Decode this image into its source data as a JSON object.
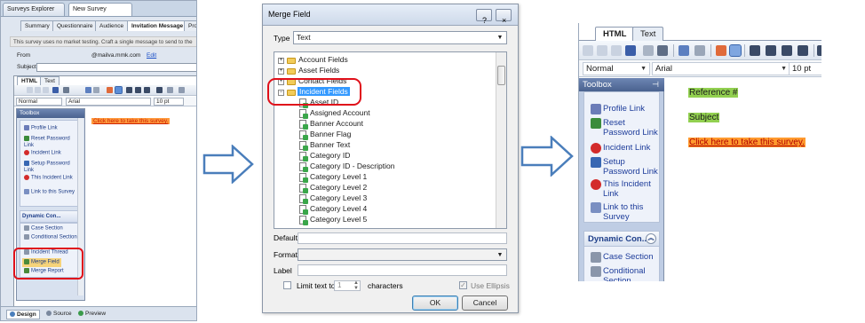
{
  "panel1": {
    "browser_tabs": [
      "Surveys Explorer",
      "New Survey"
    ],
    "sub_tabs": [
      "Summary",
      "Questionnaire",
      "Audience",
      "Invitation Message",
      "Pro"
    ],
    "banner": "This survey uses no market testing. Craft a single message to send to the",
    "from_label": "From",
    "from_value": "@mailva.mmk.com",
    "from_edit": "Edit",
    "subject_label": "Subject",
    "editor_tabs": [
      "HTML",
      "Text"
    ],
    "style_value": "Normal",
    "font_value": "Arial",
    "size_value": "10 pt",
    "toolbox_title": "Toolbox",
    "toolbox_items": [
      "Profile Link",
      "Reset Password Link",
      "Incident Link",
      "Setup Password Link",
      "This Incident Link",
      "Link to this Survey"
    ],
    "dynamic_group": "Dynamic Con...",
    "dynamic_items": [
      "Case Section",
      "Conditional Section",
      "Incident Thread",
      "Merge Field",
      "Merge Report"
    ],
    "body_link": "Click here to take this survey.",
    "bottom_tabs": [
      "Design",
      "Source",
      "Preview"
    ]
  },
  "panel2": {
    "title": "Merge Field",
    "type_label": "Type",
    "type_value": "Text",
    "tree": [
      "Account Fields",
      "Asset Fields",
      "Contact Fields",
      "Incident Fields",
      "Asset ID",
      "Assigned Account",
      "Banner Account",
      "Banner Flag",
      "Banner Text",
      "Category ID",
      "Category ID - Description",
      "Category Level 1",
      "Category Level 2",
      "Category Level 3",
      "Category Level 4",
      "Category Level 5"
    ],
    "default_label": "Default",
    "format_label": "Format",
    "label_label": "Label",
    "limit_label": "Limit text to",
    "limit_value": "1",
    "characters_label": "characters",
    "ellipsis_label": "Use Ellipsis",
    "ok_label": "OK",
    "cancel_label": "Cancel",
    "help_glyph": "?",
    "close_glyph": "×"
  },
  "panel3": {
    "tabs": [
      "HTML",
      "Text"
    ],
    "style_value": "Normal",
    "font_value": "Arial",
    "size_value": "10 pt",
    "toolbox_title": "Toolbox",
    "pin_glyph": "⊣",
    "items": [
      "Profile Link",
      "Reset Password Link",
      "Incident Link",
      "Setup Password Link",
      "This Incident Link",
      "Link to this Survey"
    ],
    "dynamic_group": "Dynamic Con...",
    "dynamic_items": [
      "Case Section",
      "Conditional Section"
    ],
    "reference": "Reference #",
    "subject": "Subject",
    "take_survey": "Click here to take this survey."
  },
  "colors": {
    "highlight_green": "#92d050",
    "highlight_orange": "#ff9a2e",
    "annotation_red": "#e0101a",
    "arrow_blue": "#4a7ebb"
  }
}
